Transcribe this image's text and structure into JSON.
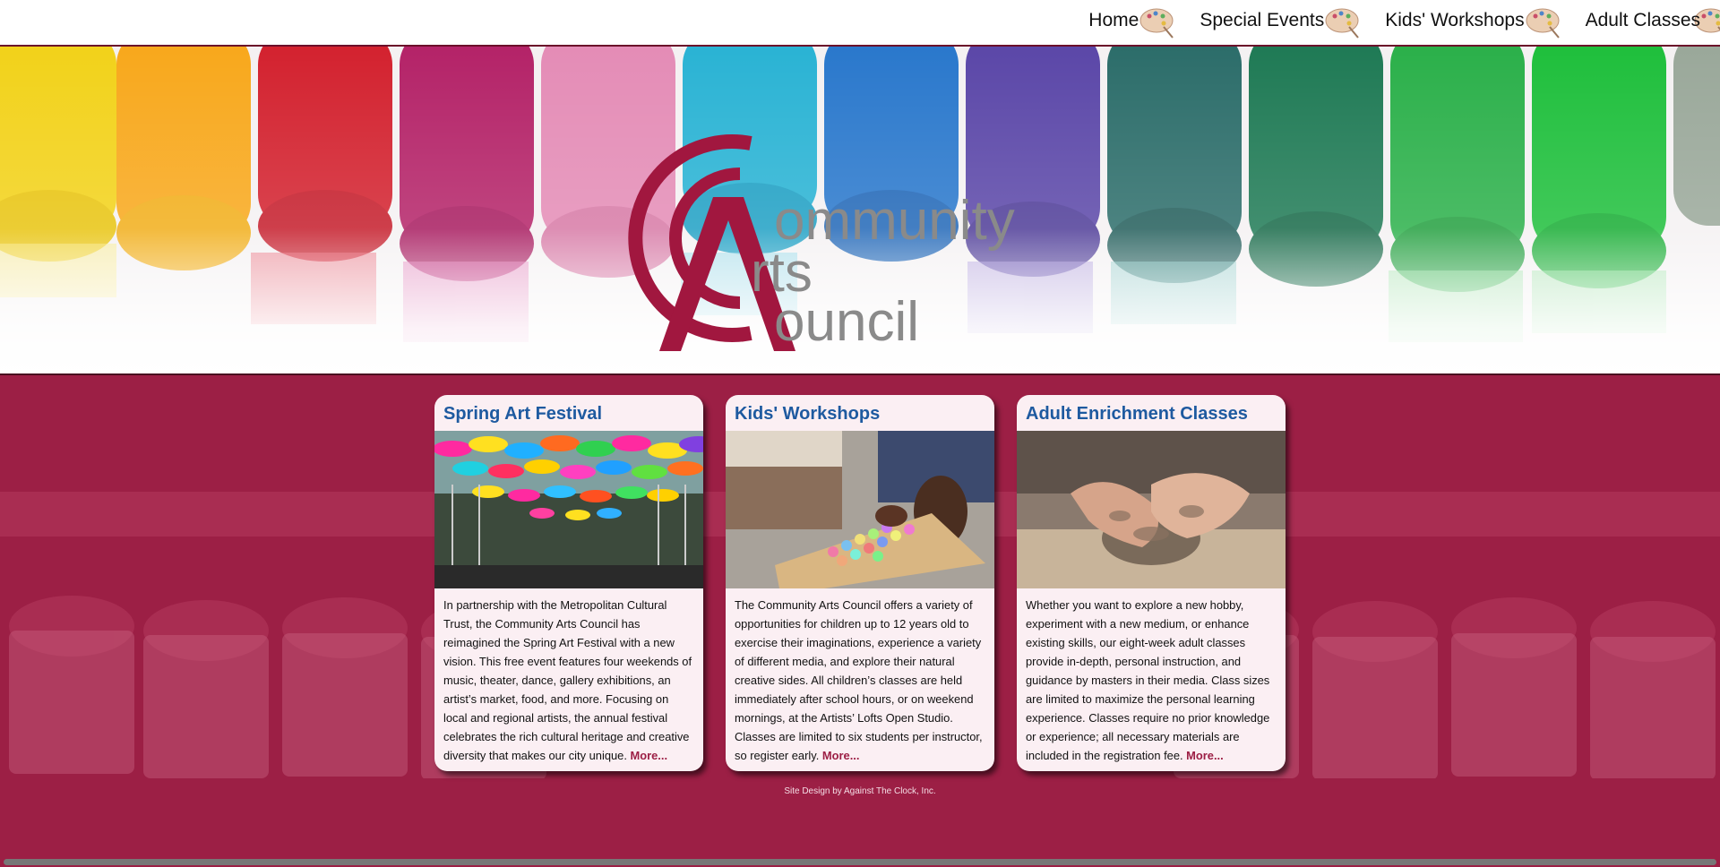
{
  "nav": {
    "items": [
      {
        "label": "Home"
      },
      {
        "label": "Special Events"
      },
      {
        "label": "Kids' Workshops"
      },
      {
        "label": "Adult Classes"
      }
    ]
  },
  "logo": {
    "word1": "ommunity",
    "word2": "rts",
    "word3": "ouncil"
  },
  "cards": [
    {
      "title": "Spring Art Festival",
      "body": "In partnership with the Metropolitan Cultural Trust, the Community Arts Council has reimagined the Spring Art Festival with a new vision. This free event features four weekends of music, theater, dance, gallery exhibitions, an artist’s market, food, and more. Focusing on local and regional artists, the annual festival celebrates the rich cultural heritage and creative diversity that makes our city unique.",
      "more": "More..."
    },
    {
      "title": "Kids' Workshops",
      "body": "The Community Arts Council offers a variety of opportunities for children up to 12 years old to exercise their imaginations, experience a variety of different media, and explore their natural creative sides. All children’s classes are held immediately after school hours, or on weekend mornings, at the Artists’ Lofts Open Studio. Classes are limited to six students per instructor, so register early.",
      "more": "More..."
    },
    {
      "title": "Adult Enrichment Classes",
      "body": "Whether you want to explore a new hobby, experiment with a new medium, or enhance existing skills, our eight-week adult classes provide in-depth, personal instruction, and guidance by masters in their media. Class sizes are limited to maximize the personal learning experience. Classes require no prior knowledge or experience; all necessary materials are included in the registration fee.",
      "more": "More..."
    }
  ],
  "footer": {
    "credit": "Site Design by Against The Clock, Inc."
  },
  "colors": {
    "brand": "#9c1f45",
    "title_blue": "#1e5aa0",
    "card_bg": "#fbeff3"
  }
}
